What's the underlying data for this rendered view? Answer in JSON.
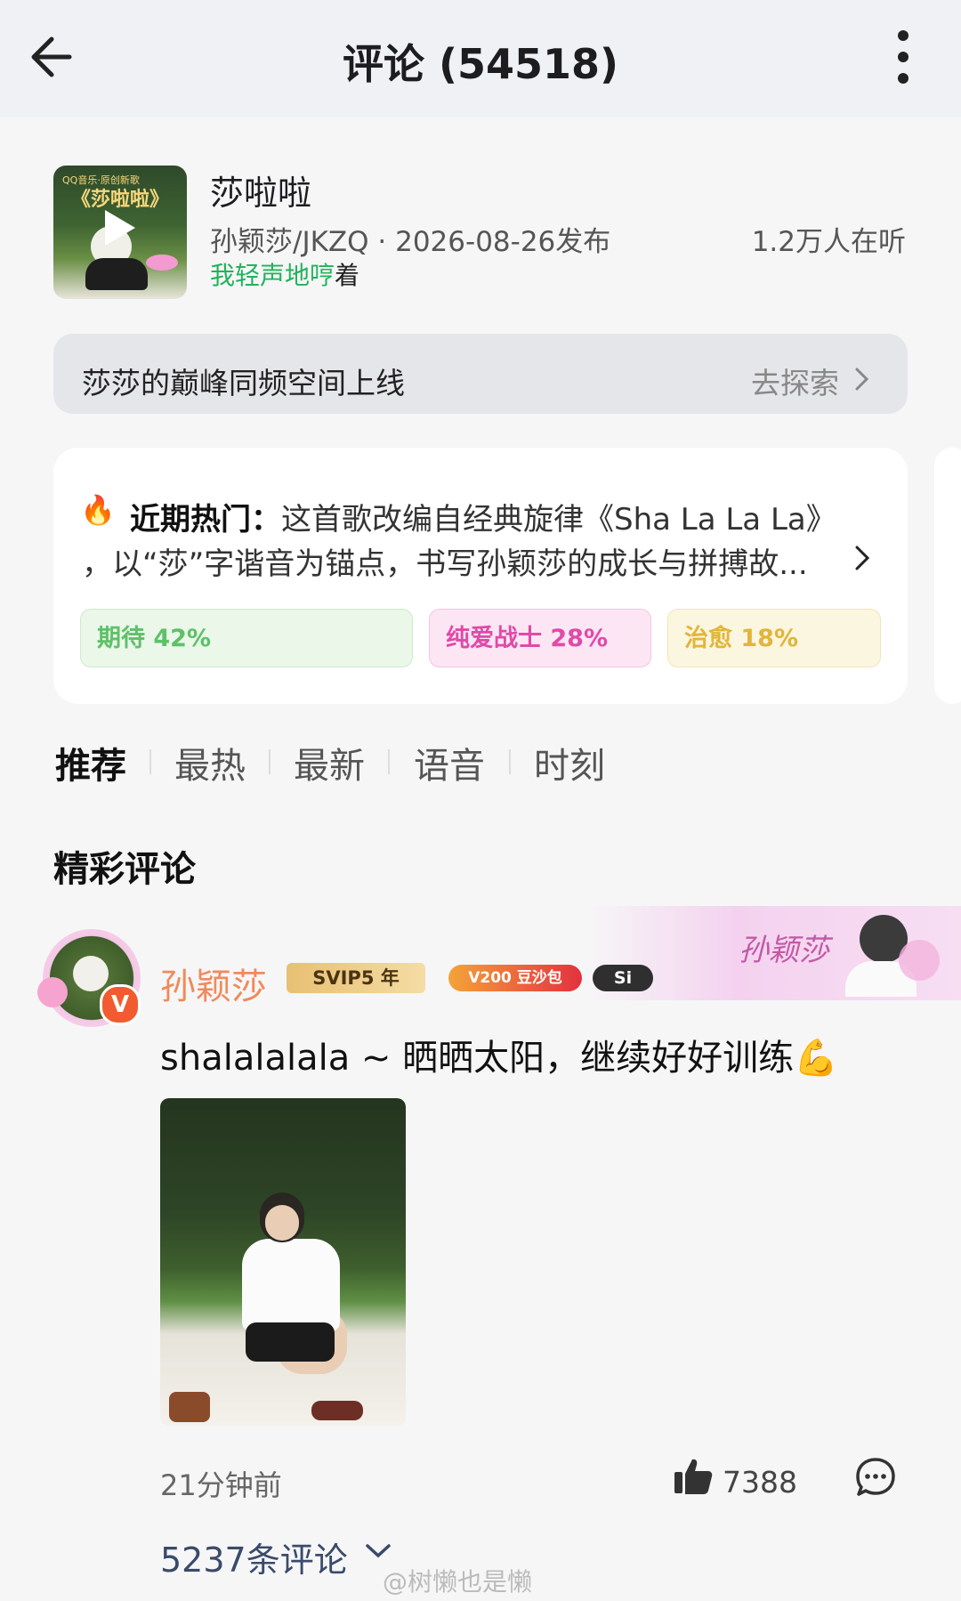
{
  "header": {
    "title": "评论 (54518)",
    "back_icon": "arrow-left-icon",
    "more_icon": "more-vertical-icon"
  },
  "song": {
    "cover_logo": "QQ音乐·原创新歌",
    "cover_title": "《莎啦啦》",
    "name": "莎啦啦",
    "meta": "孙颖莎/JKZQ · 2026-08-26发布",
    "listeners": "1.2万人在听",
    "lyric_highlight": "我轻声地哼",
    "lyric_rest": "着"
  },
  "promo": {
    "text": "莎莎的巅峰同频空间上线",
    "link": "去探索"
  },
  "hot": {
    "icon": "🔥",
    "label": "近期热门：",
    "line1": "这首歌改编自经典旋律《Sha La La La》",
    "line2": "，以“莎”字谐音为锚点，书写孙颖莎的成长与拼搏故...",
    "tags": [
      {
        "label": "期待 42%",
        "color": "#5fc06a"
      },
      {
        "label": "纯爱战士 28%",
        "color": "#e04aa8"
      },
      {
        "label": "治愈 18%",
        "color": "#e2b53a"
      }
    ]
  },
  "tabs": [
    "推荐",
    "最热",
    "最新",
    "语音",
    "时刻"
  ],
  "active_tab": "推荐",
  "section_title": "精彩评论",
  "comment": {
    "username": "孙颖莎",
    "banner_text": "孙颖莎",
    "badges": {
      "svip": "SVIP5 年",
      "level": "V200 豆沙包",
      "si": "Si"
    },
    "verified": "V",
    "text": "shalalalala ~ 晒晒太阳，继续好好训练💪",
    "time": "21分钟前",
    "likes": "7388",
    "replies": "5237条评论"
  },
  "watermark": "@树懒也是懒"
}
